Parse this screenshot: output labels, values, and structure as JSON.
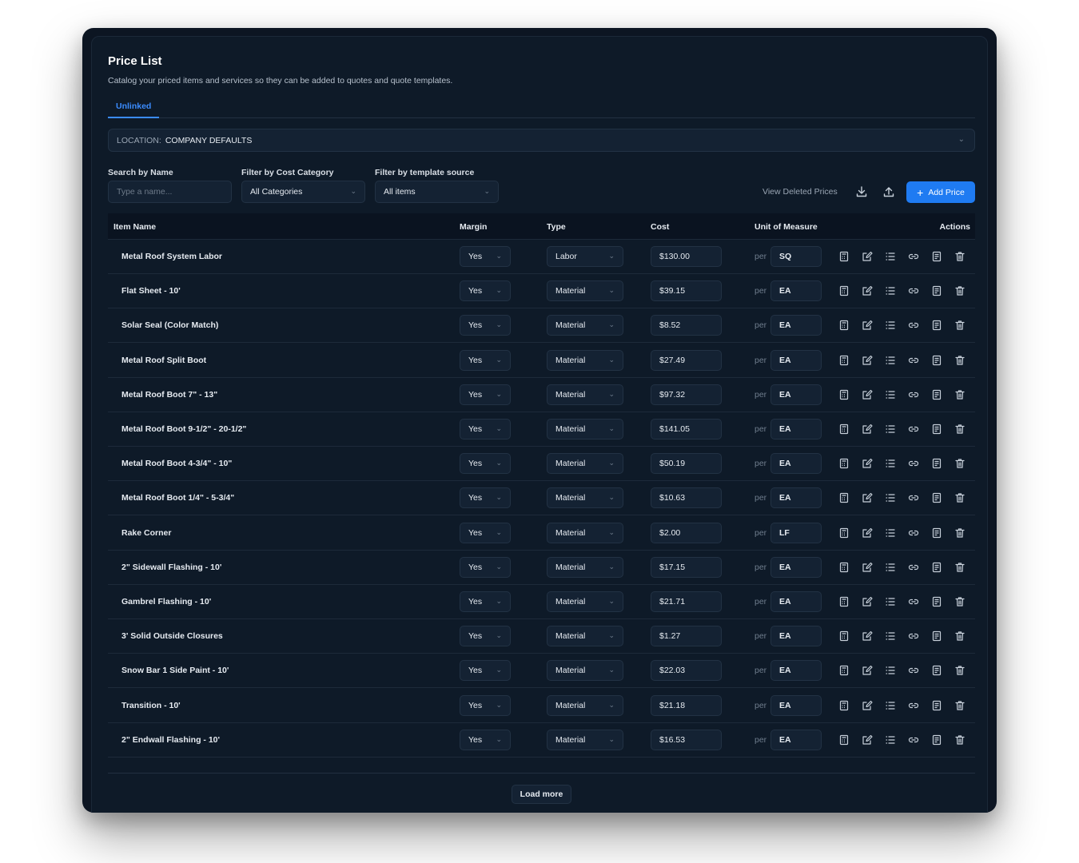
{
  "header": {
    "title": "Price List",
    "subtitle": "Catalog your priced items and services so they can be added to quotes and quote templates."
  },
  "tabs": [
    {
      "label": "Unlinked",
      "active": true
    }
  ],
  "location": {
    "label": "LOCATION:",
    "value": "COMPANY DEFAULTS"
  },
  "filters": {
    "search": {
      "label": "Search by Name",
      "placeholder": "Type a name..."
    },
    "cost_category": {
      "label": "Filter by Cost Category",
      "value": "All Categories"
    },
    "template_source": {
      "label": "Filter by template source",
      "value": "All items"
    }
  },
  "toolbar": {
    "view_deleted": "View Deleted Prices",
    "download_icon": "download-icon",
    "upload_icon": "upload-icon",
    "add_price": "Add Price"
  },
  "table": {
    "columns": {
      "item_name": "Item Name",
      "margin": "Margin",
      "type": "Type",
      "cost": "Cost",
      "uom": "Unit of Measure",
      "actions": "Actions"
    },
    "per_label": "per",
    "action_icons": [
      "calculator-icon",
      "edit-icon",
      "list-icon",
      "link-icon",
      "document-icon",
      "trash-icon"
    ],
    "rows": [
      {
        "name": "Metal Roof System Labor",
        "margin": "Yes",
        "type": "Labor",
        "cost": "$130.00",
        "uom": "SQ"
      },
      {
        "name": "Flat Sheet - 10'",
        "margin": "Yes",
        "type": "Material",
        "cost": "$39.15",
        "uom": "EA"
      },
      {
        "name": "Solar Seal (Color Match)",
        "margin": "Yes",
        "type": "Material",
        "cost": "$8.52",
        "uom": "EA"
      },
      {
        "name": "Metal Roof Split Boot",
        "margin": "Yes",
        "type": "Material",
        "cost": "$27.49",
        "uom": "EA"
      },
      {
        "name": "Metal Roof Boot 7\" - 13\"",
        "margin": "Yes",
        "type": "Material",
        "cost": "$97.32",
        "uom": "EA"
      },
      {
        "name": "Metal Roof Boot 9-1/2\" - 20-1/2\"",
        "margin": "Yes",
        "type": "Material",
        "cost": "$141.05",
        "uom": "EA"
      },
      {
        "name": "Metal Roof Boot 4-3/4\" - 10\"",
        "margin": "Yes",
        "type": "Material",
        "cost": "$50.19",
        "uom": "EA"
      },
      {
        "name": "Metal Roof Boot 1/4\" - 5-3/4\"",
        "margin": "Yes",
        "type": "Material",
        "cost": "$10.63",
        "uom": "EA"
      },
      {
        "name": "Rake Corner",
        "margin": "Yes",
        "type": "Material",
        "cost": "$2.00",
        "uom": "LF"
      },
      {
        "name": "2\" Sidewall Flashing - 10'",
        "margin": "Yes",
        "type": "Material",
        "cost": "$17.15",
        "uom": "EA"
      },
      {
        "name": "Gambrel Flashing - 10'",
        "margin": "Yes",
        "type": "Material",
        "cost": "$21.71",
        "uom": "EA"
      },
      {
        "name": "3' Solid Outside Closures",
        "margin": "Yes",
        "type": "Material",
        "cost": "$1.27",
        "uom": "EA"
      },
      {
        "name": "Snow Bar 1 Side Paint - 10'",
        "margin": "Yes",
        "type": "Material",
        "cost": "$22.03",
        "uom": "EA"
      },
      {
        "name": "Transition - 10'",
        "margin": "Yes",
        "type": "Material",
        "cost": "$21.18",
        "uom": "EA"
      },
      {
        "name": "2\" Endwall Flashing - 10'",
        "margin": "Yes",
        "type": "Material",
        "cost": "$16.53",
        "uom": "EA"
      }
    ]
  },
  "footer": {
    "load_more": "Load more"
  },
  "colors": {
    "accent": "#1f7bf2",
    "background": "#0e1a28",
    "tab_active": "#3b8cff"
  }
}
